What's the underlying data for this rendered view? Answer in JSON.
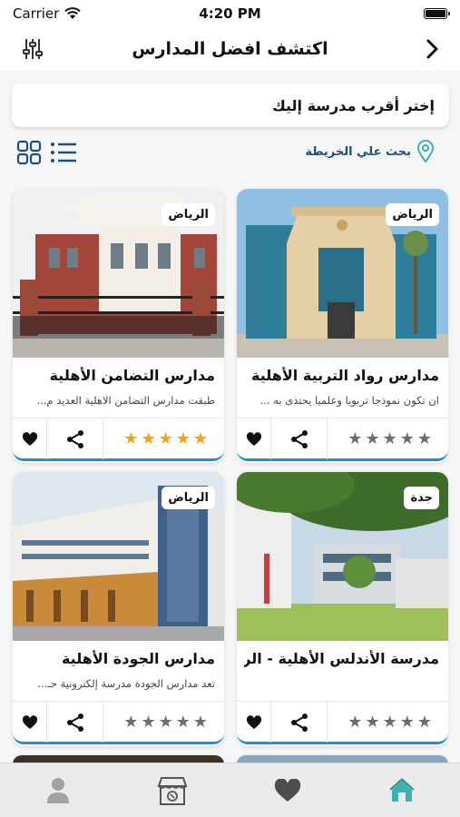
{
  "status_bar": {
    "carrier": "Carrier",
    "time": "4:20 PM"
  },
  "header": {
    "title": "اكتشف افضل المدارس",
    "back_icon": "chevron-right-icon",
    "filter_icon": "sliders-icon"
  },
  "search": {
    "placeholder": "إختر أقرب مدرسة إليك"
  },
  "toolbar": {
    "map_label": "بحث علي الخريطة",
    "map_icon": "map-pin-icon",
    "grid_icon": "grid-view-icon",
    "list_icon": "list-view-icon"
  },
  "colors": {
    "accent": "#1e8fd8",
    "star_active": "#f0a416",
    "star_inactive": "#6d6d6d",
    "link": "#1a4f7a",
    "home_active": "#3fb0b0"
  },
  "schools": [
    {
      "city": "الرياض",
      "name": "مدارس رواد التربية الأهلية",
      "description": "ان تكون نموذجا تربويا وعلميا يحتذى به ...",
      "rating": 0
    },
    {
      "city": "الرياض",
      "name": "مدارس التضامن الأهلية",
      "description": "طبقت مدارس التضامن الاهلية العديد م...",
      "rating": 5
    },
    {
      "city": "جدة",
      "name": "مدرسة الأندلس الأهلية - الر...",
      "description": "",
      "rating": 0
    },
    {
      "city": "الرياض",
      "name": "مدارس الجودة الأهلية",
      "description": "تعد مدارس الجودة مدرسة إلكترونية حـ...",
      "rating": 0
    }
  ],
  "tabs": [
    {
      "name": "home",
      "icon": "home-icon",
      "active": true
    },
    {
      "name": "favorites",
      "icon": "heart-icon",
      "active": false
    },
    {
      "name": "store",
      "icon": "store-icon",
      "active": false
    },
    {
      "name": "profile",
      "icon": "user-icon",
      "active": false
    }
  ]
}
